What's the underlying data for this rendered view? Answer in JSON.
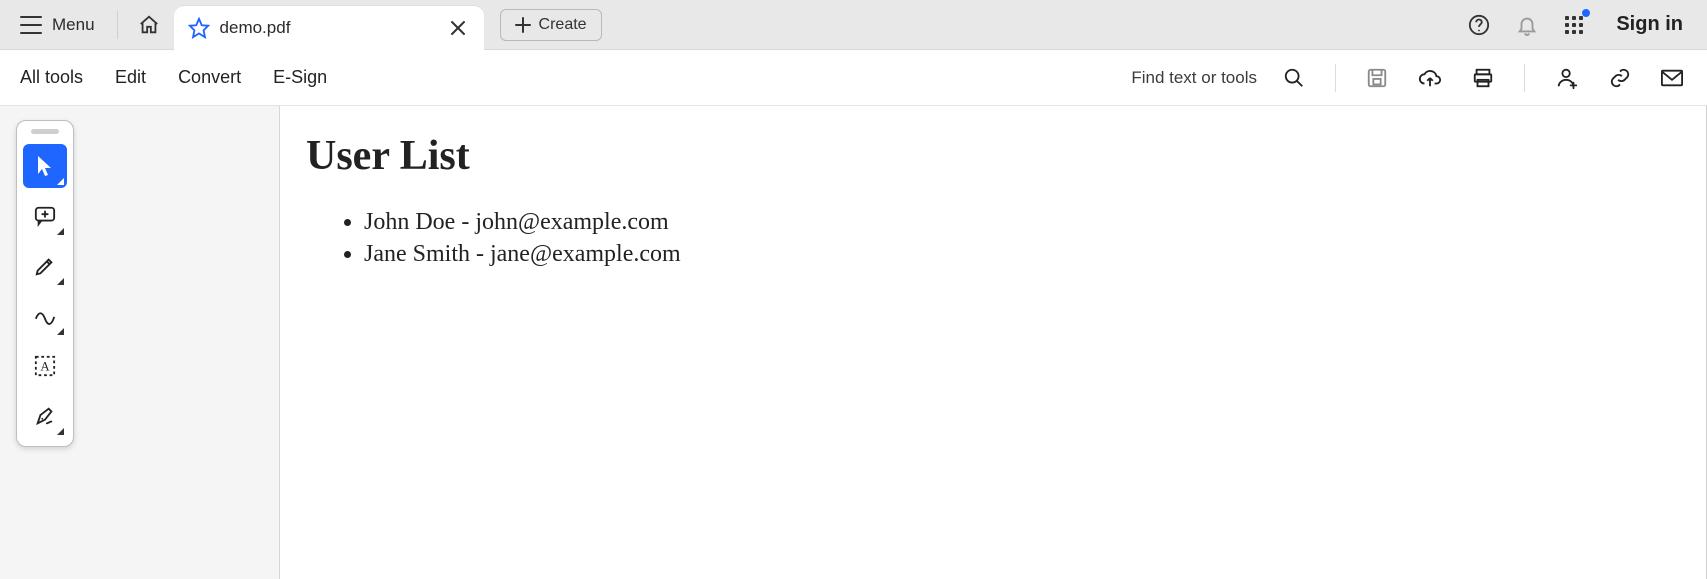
{
  "topbar": {
    "menu_label": "Menu",
    "tab": {
      "title": "demo.pdf"
    },
    "create_label": "Create",
    "signin_label": "Sign in"
  },
  "toolbar": {
    "items": [
      "All tools",
      "Edit",
      "Convert",
      "E-Sign"
    ],
    "find_label": "Find text or tools"
  },
  "document": {
    "heading": "User List",
    "items": [
      "John Doe - john@example.com",
      "Jane Smith - jane@example.com"
    ]
  }
}
